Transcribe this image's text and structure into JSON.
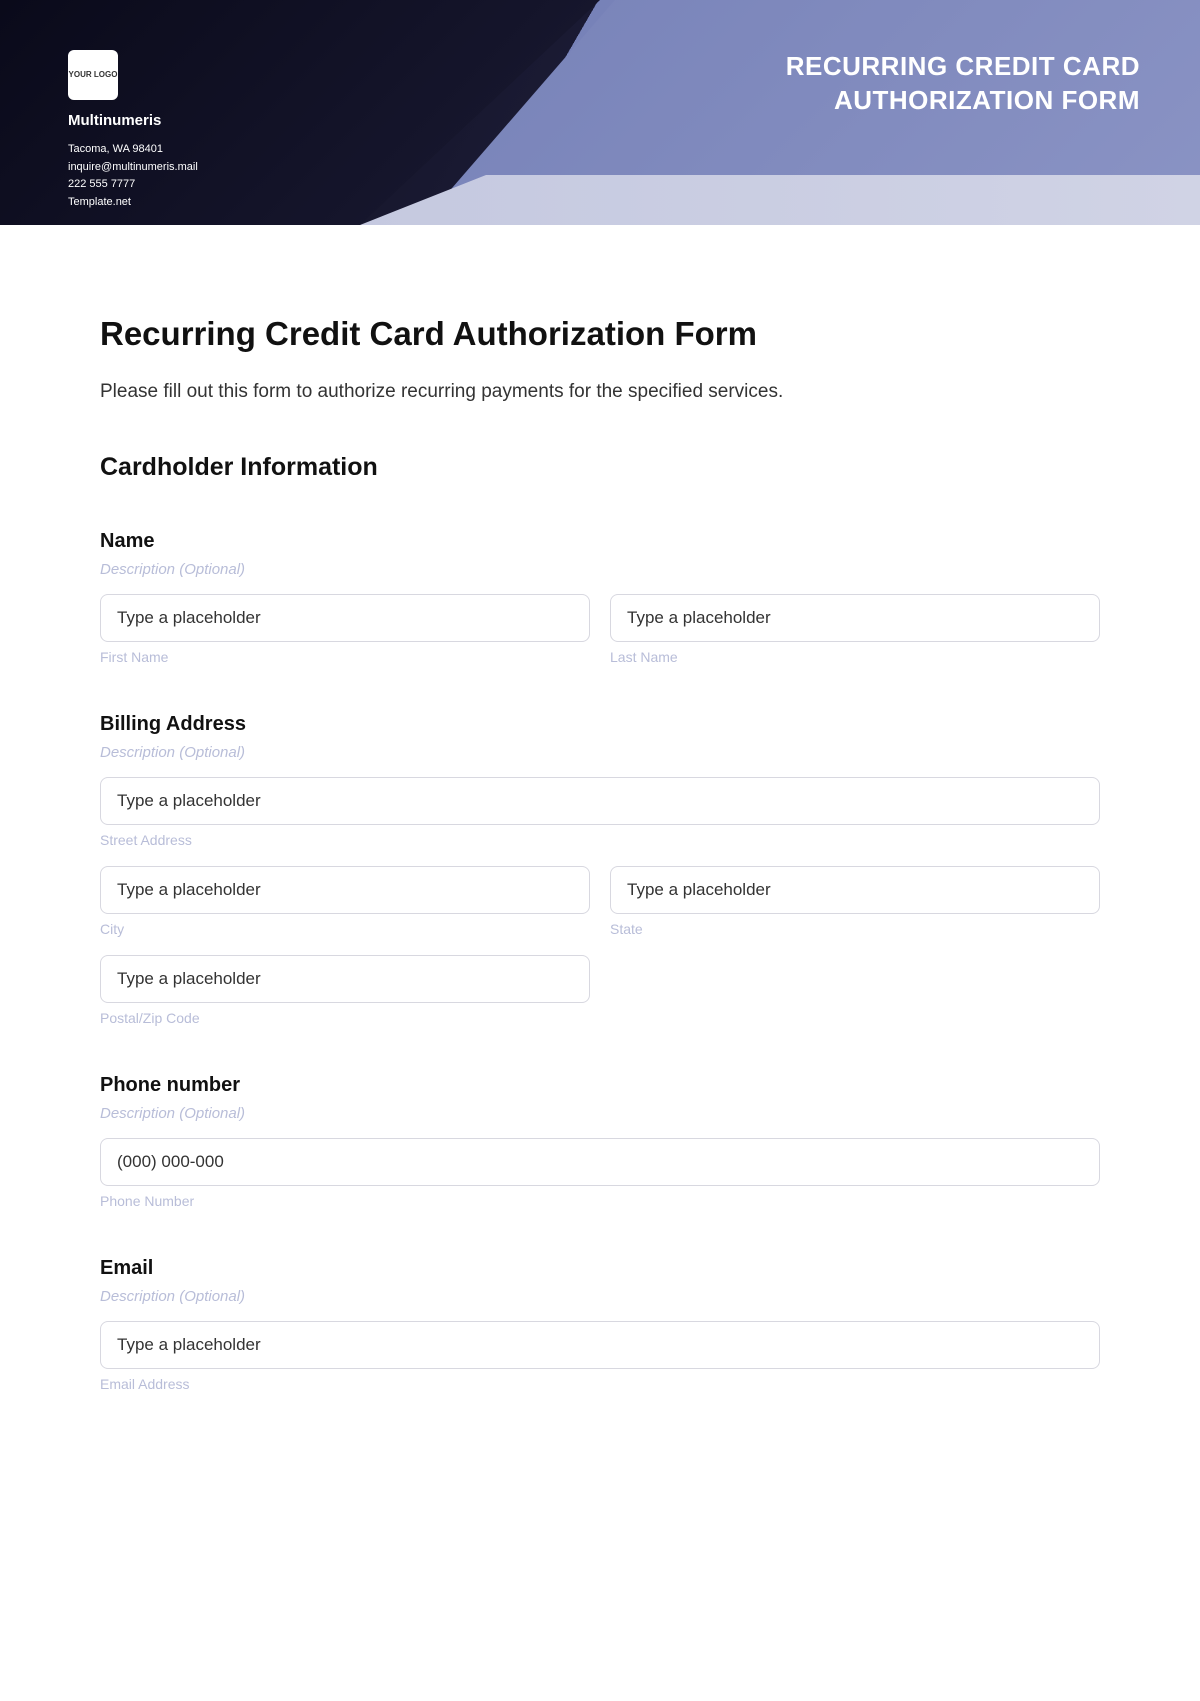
{
  "header": {
    "logo_text": "YOUR LOGO",
    "company": "Multinumeris",
    "address": "Tacoma, WA 98401",
    "email": "inquire@multinumeris.mail",
    "phone": "222 555 7777",
    "website": "Template.net",
    "title_line1": "RECURRING CREDIT CARD",
    "title_line2": "AUTHORIZATION FORM"
  },
  "form": {
    "title": "Recurring Credit Card Authorization Form",
    "subtitle": "Please fill out this form to authorize recurring payments for the specified services.",
    "section_cardholder": "Cardholder Information",
    "description_optional": "Description (Optional)",
    "placeholder_text": "Type a placeholder",
    "name": {
      "label": "Name",
      "first_sublabel": "First Name",
      "last_sublabel": "Last Name"
    },
    "billing": {
      "label": "Billing Address",
      "street_sublabel": "Street Address",
      "city_sublabel": "City",
      "state_sublabel": "State",
      "postal_sublabel": "Postal/Zip Code"
    },
    "phone": {
      "label": "Phone number",
      "placeholder": "(000) 000-000",
      "sublabel": "Phone Number"
    },
    "emailf": {
      "label": "Email",
      "sublabel": "Email Address"
    }
  }
}
